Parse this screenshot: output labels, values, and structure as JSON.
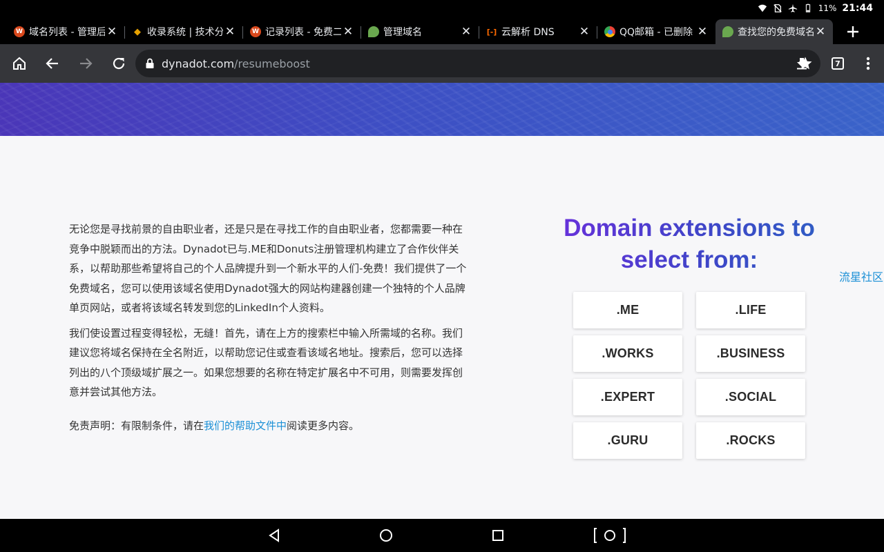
{
  "status_bar": {
    "battery": "11%",
    "time": "21:44"
  },
  "tabs": [
    {
      "title": "域名列表 - 管理后",
      "favicon_color": "#d9481c",
      "favicon_glyph": "W"
    },
    {
      "title": "收录系统 | 技术分",
      "favicon_color": "#e6a100",
      "favicon_glyph": "◆"
    },
    {
      "title": "记录列表 - 免费二",
      "favicon_color": "#d9481c",
      "favicon_glyph": "W"
    },
    {
      "title": "管理域名",
      "favicon_color": "#6aa84f",
      "favicon_glyph": "●"
    },
    {
      "title": "云解析 DNS",
      "favicon_color": "#ff6a00",
      "favicon_glyph": "[-]"
    },
    {
      "title": "QQ邮箱 - 已删除",
      "favicon_color": "#4285f4",
      "favicon_glyph": "◎"
    },
    {
      "title": "查找您的免费域名",
      "favicon_color": "#6aa84f",
      "favicon_glyph": "●",
      "active": true
    }
  ],
  "toolbar": {
    "url_host": "dynadot.com",
    "url_path": "/resumeboost",
    "tab_count": "7"
  },
  "content": {
    "paragraph1": "无论您是寻找前景的自由职业者，还是只是在寻找工作的自由职业者，您都需要一种在竞争中脱颖而出的方法。Dynadot已与.ME和Donuts注册管理机构建立了合作伙伴关系，以帮助那些希望将自己的个人品牌提升到一个新水平的人们-免费！我们提供了一个免费域名，您可以使用该域名使用Dynadot强大的网站构建器创建一个独特的个人品牌单页网站，或者将该域名转发到您的LinkedIn个人资料。",
    "paragraph2": "我们使设置过程变得轻松，无缝！首先，请在上方的搜索栏中输入所需域的名称。我们建议您将域名保持在全名附近，以帮助您记住或查看该域名地址。搜索后，您可以选择列出的八个顶级域扩展之一。如果您想要的名称在特定扩展名中不可用，则需要发挥创意并尝试其他方法。",
    "disclaimer_prefix": "免责声明：有限制条件，请在",
    "disclaimer_link": "我们的帮助文件中",
    "disclaimer_suffix": "阅读更多内容。"
  },
  "extensions": {
    "title_line1": "Domain extensions to",
    "title_line2": "select from:",
    "items": [
      ".ME",
      ".LIFE",
      ".WORKS",
      ".BUSINESS",
      ".EXPERT",
      ".SOCIAL",
      ".GURU",
      ".ROCKS"
    ]
  },
  "side_link": "流星社区"
}
